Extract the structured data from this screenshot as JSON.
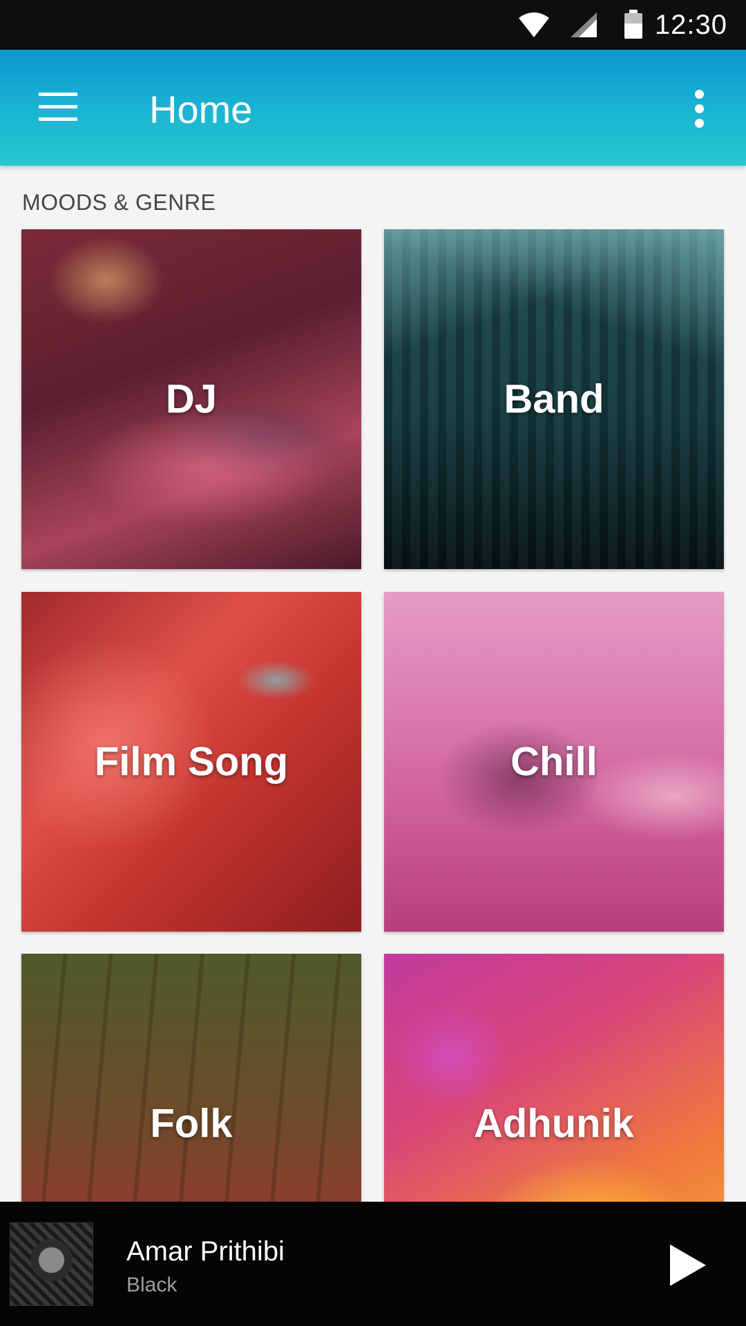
{
  "status_bar": {
    "time": "12:30",
    "icons": [
      "wifi-icon",
      "signal-icon",
      "battery-icon"
    ]
  },
  "app_bar": {
    "title": "Home",
    "nav_icon": "hamburger-menu-icon",
    "overflow_icon": "more-vert-icon",
    "colors": {
      "gradient_top": "#0b99cf",
      "gradient_bottom": "#2ac6d0"
    }
  },
  "section": {
    "title": "MOODS & GENRE"
  },
  "genres": [
    {
      "label": "DJ"
    },
    {
      "label": "Band"
    },
    {
      "label": "Film Song"
    },
    {
      "label": "Chill"
    },
    {
      "label": "Folk"
    },
    {
      "label": "Adhunik"
    }
  ],
  "now_playing": {
    "song": "Amar Prithibi",
    "artist": "Black",
    "control_icon": "play-icon"
  }
}
